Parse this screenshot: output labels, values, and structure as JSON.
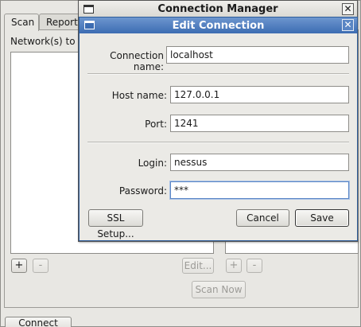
{
  "main": {
    "tabs": [
      {
        "label": "Scan"
      },
      {
        "label": "Report"
      }
    ],
    "networks_label": "Network(s) to sc",
    "left_add": "+",
    "left_remove": "-",
    "edit_label": "Edit...",
    "right_add": "+",
    "right_remove": "-",
    "scan_now_label": "Scan Now",
    "connect_label": "Connect"
  },
  "connection_manager": {
    "title": "Connection Manager",
    "close_glyph": "✕"
  },
  "edit_connection": {
    "title": "Edit Connection",
    "close_glyph": "✕",
    "connection_name_label": "Connection name:",
    "connection_name_value": "localhost",
    "host_name_label": "Host name:",
    "host_name_value": "127.0.0.1",
    "port_label": "Port:",
    "port_value": "1241",
    "login_label": "Login:",
    "login_value": "nessus",
    "password_label": "Password:",
    "password_value": "***",
    "ssl_setup_label": "SSL Setup...",
    "cancel_label": "Cancel",
    "save_label": "Save"
  },
  "icons": {
    "window_menu_icon": "window-menu-icon",
    "close_icon": "close-icon"
  }
}
